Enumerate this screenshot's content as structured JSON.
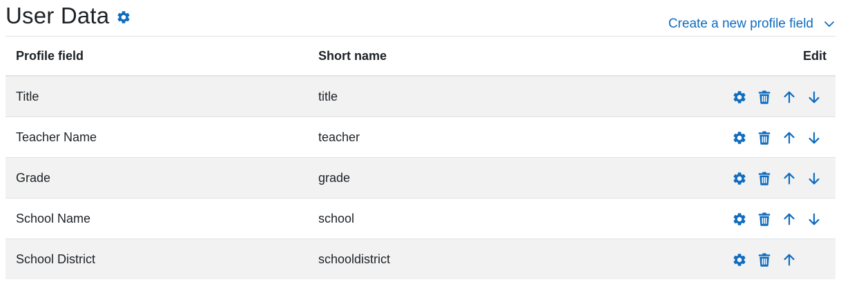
{
  "header": {
    "title": "User Data",
    "create_link_label": "Create a new profile field"
  },
  "table": {
    "columns": [
      "Profile field",
      "Short name",
      "Edit"
    ],
    "rows": [
      {
        "profile_field": "Title",
        "short_name": "title",
        "actions": [
          "settings",
          "delete",
          "move-up",
          "move-down"
        ]
      },
      {
        "profile_field": "Teacher Name",
        "short_name": "teacher",
        "actions": [
          "settings",
          "delete",
          "move-up",
          "move-down"
        ]
      },
      {
        "profile_field": "Grade",
        "short_name": "grade",
        "actions": [
          "settings",
          "delete",
          "move-up",
          "move-down"
        ]
      },
      {
        "profile_field": "School Name",
        "short_name": "school",
        "actions": [
          "settings",
          "delete",
          "move-up",
          "move-down"
        ]
      },
      {
        "profile_field": "School District",
        "short_name": "schooldistrict",
        "actions": [
          "settings",
          "delete",
          "move-up"
        ]
      }
    ]
  },
  "icons": {
    "title": "gear-icon",
    "create_link": "chevron-down-icon",
    "row_actions": [
      "gear-icon",
      "trash-icon",
      "arrow-up-icon",
      "arrow-down-icon"
    ]
  },
  "colors": {
    "accent": "#0f6cbf",
    "text": "#1d2125",
    "stripe": "#f2f2f2",
    "border": "#dee2e6"
  }
}
